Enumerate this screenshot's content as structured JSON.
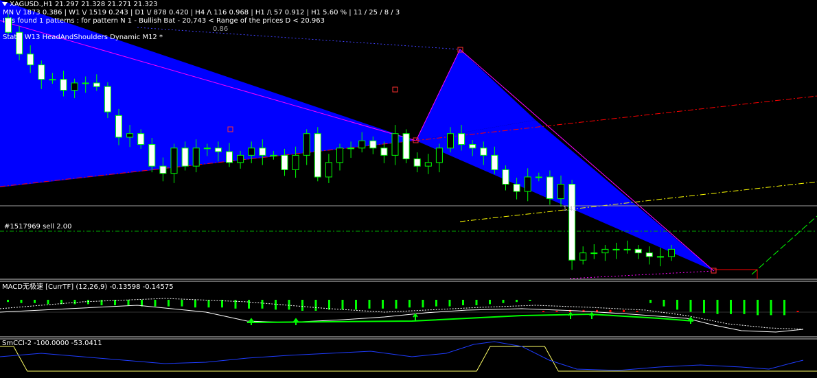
{
  "header": {
    "symbol_line": "XAGUSD.,H1  21.297 21.328 21.271 21.323",
    "tf_line": "MN \\/ 1873   0.386  |  W1 \\/ 1519   0.243  |  D1 \\/ 878   0.420  |  H4 /\\ 116   0.968  |  H1 /\\ 57   0.912  |  H1  5.60 %  |  11 / 25 / 8 / 3",
    "pattern_line": "It is found 1 patterns :  for pattern N 1 - Bullish Bat - 20,743 < Range of the prices D < 20.963",
    "fib_ratio": "0.86",
    "static_line": "Static  W13  HeadAndShoulders  Dynamic  M12  *"
  },
  "main": {
    "order_label": "#1517969 sell 2.00",
    "ratio_label": "1.41"
  },
  "macd": {
    "title": "MACD无极速 [CurrTF] (12,26,9) -0.13598 -0.14575"
  },
  "cci": {
    "title": "SmCCI-2 -100.0000 -53.0411"
  },
  "colors": {
    "background": "#000000",
    "bull_candle": "#00ff00",
    "bear_candle": "#ffffff",
    "pattern_fill": "#0000ff",
    "pattern_outline": "#ff00ff",
    "trend_red": "#ff0000",
    "trend_yellow": "#ffff00",
    "hist_green": "#00ff00",
    "hist_red": "#ff0000",
    "cci_yellow": "#ffff66",
    "cci_blue": "#1e3cff"
  },
  "chart_data": [
    {
      "type": "candlestick",
      "series_o": [
        21.08,
        21.04,
        20.98,
        20.95,
        20.91,
        20.91,
        20.88,
        20.9,
        20.9,
        20.89,
        20.81,
        20.75,
        20.76,
        20.73,
        20.67,
        20.65,
        20.72,
        20.67,
        20.72,
        20.72,
        20.71,
        20.68,
        20.7,
        20.72,
        20.7,
        20.7,
        20.66,
        20.7,
        20.76,
        20.64,
        20.68,
        20.72,
        20.72,
        20.74,
        20.72,
        20.7,
        20.76,
        20.69,
        20.67,
        20.68,
        20.72,
        20.76,
        20.73,
        20.72,
        20.7,
        20.66,
        20.62,
        20.6,
        20.64,
        20.64,
        20.58,
        20.62,
        20.41,
        20.43,
        20.43,
        20.44,
        20.44,
        20.44,
        20.43,
        20.42,
        20.42
      ],
      "series_c": [
        21.04,
        20.98,
        20.95,
        20.91,
        20.91,
        20.88,
        20.9,
        20.9,
        20.89,
        20.82,
        20.75,
        20.76,
        20.73,
        20.67,
        20.65,
        20.72,
        20.67,
        20.72,
        20.72,
        20.71,
        20.68,
        20.7,
        20.72,
        20.7,
        20.7,
        20.66,
        20.7,
        20.76,
        20.64,
        20.68,
        20.72,
        20.72,
        20.74,
        20.72,
        20.7,
        20.76,
        20.69,
        20.67,
        20.68,
        20.72,
        20.76,
        20.73,
        20.72,
        20.7,
        20.66,
        20.62,
        20.6,
        20.64,
        20.64,
        20.58,
        20.62,
        20.41,
        20.43,
        20.43,
        20.44,
        20.44,
        20.44,
        20.43,
        20.42,
        20.42,
        20.44
      ],
      "grid": false
    },
    {
      "type": "bar",
      "name": "MACD histogram",
      "values": [
        -0.02,
        -0.03,
        -0.03,
        -0.04,
        -0.04,
        -0.04,
        -0.04,
        -0.05,
        -0.05,
        -0.05,
        -0.06,
        -0.06,
        -0.06,
        -0.06,
        -0.07,
        -0.07,
        -0.07,
        -0.08,
        -0.08,
        -0.08,
        -0.09,
        -0.09,
        -0.1,
        -0.1,
        -0.09,
        -0.09,
        -0.09,
        -0.08,
        -0.08,
        -0.08,
        -0.07,
        -0.07,
        -0.06,
        -0.06,
        -0.05,
        -0.05,
        -0.04,
        -0.03,
        -0.02,
        -0.01,
        0.01,
        0.01,
        0.02,
        0.02,
        0.02,
        0.02,
        0.02,
        0.01,
        -0.03,
        -0.06,
        -0.09,
        -0.11,
        -0.12,
        -0.13,
        -0.13,
        -0.13,
        -0.14,
        -0.14,
        -0.14,
        0.01
      ]
    },
    {
      "type": "line",
      "name": "SmCCI-2",
      "values": [
        100,
        100,
        -100,
        -100,
        -100,
        -100,
        -100,
        -100,
        -100,
        -100,
        -100,
        -100,
        -100,
        -100,
        -100,
        -100,
        -100,
        -100,
        -100,
        -100,
        -100,
        -100,
        -100,
        -100,
        -100,
        -100,
        -100,
        -100,
        -100,
        -100,
        -100,
        -100,
        -100,
        -100,
        -100,
        -100,
        100,
        100,
        100,
        100,
        100,
        -100,
        -100,
        -100,
        -100,
        -100,
        -100,
        -100,
        -100,
        -100,
        -100,
        -100,
        -100,
        -100,
        -100,
        -100,
        -100,
        -100,
        -100,
        -100,
        -100
      ],
      "ylim": [
        -150,
        150
      ]
    }
  ]
}
